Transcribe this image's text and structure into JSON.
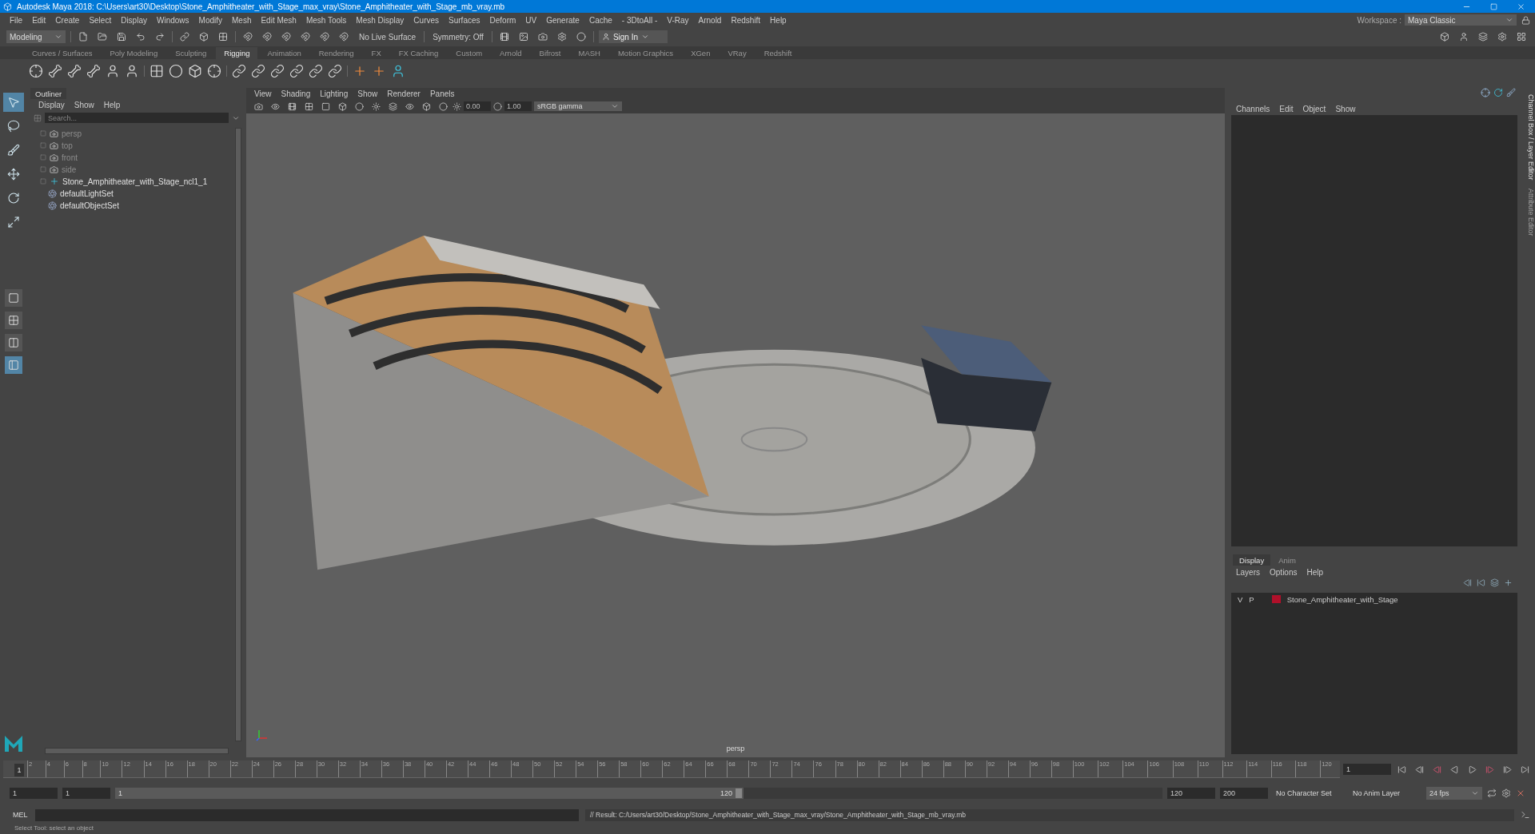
{
  "window": {
    "title": "Autodesk Maya 2018: C:\\Users\\art30\\Desktop\\Stone_Amphitheater_with_Stage_max_vray\\Stone_Amphitheater_with_Stage_mb_vray.mb"
  },
  "menu_bar": [
    "File",
    "Edit",
    "Create",
    "Select",
    "Display",
    "Windows",
    "Modify",
    "Mesh",
    "Edit Mesh",
    "Mesh Tools",
    "Mesh Display",
    "Curves",
    "Surfaces",
    "Deform",
    "UV",
    "Generate",
    "Cache",
    "- 3DtoAll -",
    "V-Ray",
    "Arnold",
    "Redshift",
    "Help"
  ],
  "workspace": {
    "label": "Workspace :",
    "value": "Maya Classic"
  },
  "status_line": {
    "mode": "Modeling",
    "live_surface": "No Live Surface",
    "symmetry": "Symmetry: Off",
    "sign_in": "Sign In"
  },
  "shelf_tabs": [
    {
      "label": "Curves / Surfaces",
      "selected": false
    },
    {
      "label": "Poly Modeling",
      "selected": false
    },
    {
      "label": "Sculpting",
      "selected": false
    },
    {
      "label": "Rigging",
      "selected": true
    },
    {
      "label": "Animation",
      "selected": false
    },
    {
      "label": "Rendering",
      "selected": false
    },
    {
      "label": "FX",
      "selected": false
    },
    {
      "label": "FX Caching",
      "selected": false
    },
    {
      "label": "Custom",
      "selected": false
    },
    {
      "label": "Arnold",
      "selected": false
    },
    {
      "label": "Bifrost",
      "selected": false
    },
    {
      "label": "MASH",
      "selected": false
    },
    {
      "label": "Motion Graphics",
      "selected": false
    },
    {
      "label": "XGen",
      "selected": false
    },
    {
      "label": "VRay",
      "selected": false
    },
    {
      "label": "Redshift",
      "selected": false
    }
  ],
  "tools": [
    {
      "kind": "select",
      "selected": true
    },
    {
      "kind": "lasso",
      "selected": false
    },
    {
      "kind": "paint",
      "selected": false
    },
    {
      "kind": "move",
      "selected": false
    },
    {
      "kind": "rotate",
      "selected": false
    },
    {
      "kind": "scale",
      "selected": false
    }
  ],
  "layouts": [
    {
      "kind": "single",
      "selected": false
    },
    {
      "kind": "four",
      "selected": false
    },
    {
      "kind": "split",
      "selected": false
    },
    {
      "kind": "outliner",
      "selected": true
    }
  ],
  "outliner": {
    "title": "Outliner",
    "menus": [
      "Display",
      "Show",
      "Help"
    ],
    "search": {
      "placeholder": "Search..."
    },
    "items": [
      {
        "kind": "camera",
        "label": "persp",
        "dimmed": true
      },
      {
        "kind": "camera",
        "label": "top",
        "dimmed": true
      },
      {
        "kind": "camera",
        "label": "front",
        "dimmed": true
      },
      {
        "kind": "camera",
        "label": "side",
        "dimmed": true
      },
      {
        "kind": "group",
        "label": "Stone_Amphitheater_with_Stage_ncl1_1",
        "dimmed": false
      },
      {
        "kind": "set",
        "label": "defaultLightSet",
        "dimmed": false
      },
      {
        "kind": "set",
        "label": "defaultObjectSet",
        "dimmed": false
      }
    ]
  },
  "viewport": {
    "menus": [
      "View",
      "Shading",
      "Lighting",
      "Show",
      "Renderer",
      "Panels"
    ],
    "exposure": "0.00",
    "gamma": "1.00",
    "color_space": "sRGB gamma",
    "camera_label": "persp"
  },
  "channel_box": {
    "menus": [
      "Channels",
      "Edit",
      "Object",
      "Show"
    ]
  },
  "layer_editor": {
    "tabs": [
      {
        "label": "Display",
        "selected": true
      },
      {
        "label": "Anim",
        "selected": false
      }
    ],
    "menus": [
      "Layers",
      "Options",
      "Help"
    ],
    "layers": [
      {
        "visible": "V",
        "playback": "P",
        "color": "#b0102a",
        "name": "Stone_Amphitheater_with_Stage"
      }
    ]
  },
  "side_tabs": [
    "Channel Box / Layer Editor",
    "Attribute Editor"
  ],
  "time_slider": {
    "current": "1",
    "level": 0,
    "ticks": [
      "2",
      "4",
      "6",
      "8",
      "10",
      "12",
      "14",
      "16",
      "18",
      "20",
      "22",
      "24",
      "26",
      "28",
      "30",
      "32",
      "34",
      "36",
      "38",
      "40",
      "42",
      "44",
      "46",
      "48",
      "50",
      "52",
      "54",
      "56",
      "58",
      "60",
      "62",
      "64",
      "66",
      "68",
      "70",
      "72",
      "74",
      "76",
      "78",
      "80",
      "82",
      "84",
      "86",
      "88",
      "90",
      "92",
      "94",
      "96",
      "98",
      "100",
      "102",
      "104",
      "106",
      "108",
      "110",
      "112",
      "114",
      "116",
      "118",
      "120"
    ],
    "frame_field": "1"
  },
  "range_slider": {
    "level": 0.6,
    "start": "1",
    "playback_start": "1",
    "range_start": "1",
    "range_end": "120",
    "playback_end": "120",
    "end": "200",
    "character_set": "No Character Set",
    "anim_layer": "No Anim Layer",
    "fps": "24 fps"
  },
  "command_line": {
    "language": "MEL",
    "result": "// Result: C:/Users/art30/Desktop/Stone_Amphitheater_with_Stage_max_vray/Stone_Amphitheater_with_Stage_mb_vray.mb"
  },
  "help_line": "Select Tool: select an object"
}
